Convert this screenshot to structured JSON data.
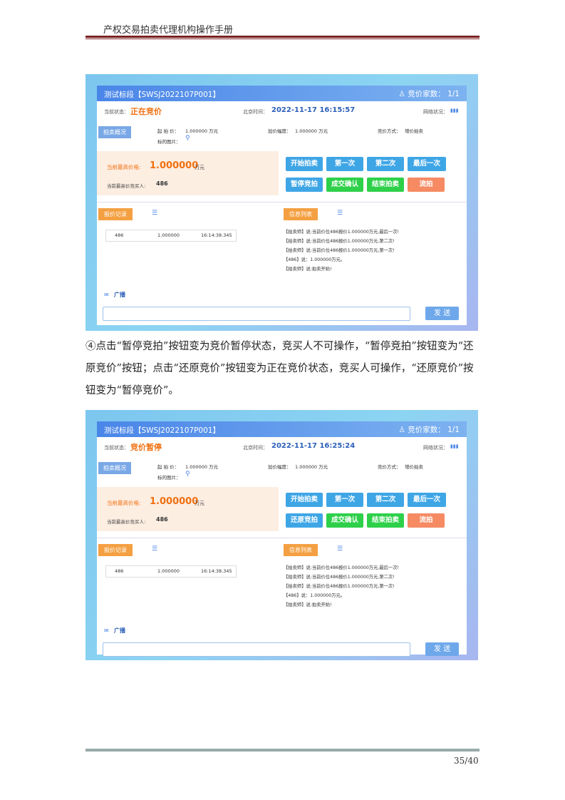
{
  "header": {
    "title": "产权交易拍卖代理机构操作手册"
  },
  "footer": {
    "page": "35/40"
  },
  "paragraph": [
    "④点击“暂停竞拍”按钮变为竞价暂停状态，竞买人不可操作，“暂停竞拍”按钮变为“还",
    "原竞价”按钮；点击“还原竞价”按钮变为正在竞价状态，竞买人可操作，“还原竞价”按",
    "钮变为“暂停竞价”。"
  ],
  "screens": [
    {
      "title": "测试标段【SWSJ2022107P001】",
      "bidder_count_label": "竞价家数：",
      "bidder_count": "1/1",
      "state_label": "当前状态：",
      "state": "正在竞价",
      "time_label": "北京时间：",
      "time": "2022-11-17 16:15:57",
      "network_label": "网络状况：",
      "overview_tag": "拍卖概况",
      "start_price_label": "起 拍 价：",
      "start_price": "1.000000 万元",
      "increment_label": "加价幅度：",
      "increment": "1.000000 万元",
      "method_label": "竞价方式：",
      "method": "增价拍卖",
      "image_label": "标的图片：",
      "high_label": "当前最高价格:",
      "high_value": "1.000000",
      "high_unit": "万元",
      "buyer_label": "当前最高价竞买人:",
      "buyer": "486",
      "buttons": [
        "开始拍卖",
        "第一次",
        "第二次",
        "最后一次",
        "暂停竞拍",
        "成交确认",
        "结束拍卖",
        "流拍"
      ],
      "record_tag": "报价记录",
      "info_tag": "信息列表",
      "record": {
        "bidder": "486",
        "price": "1.000000",
        "time": "16:14:38.345"
      },
      "messages": [
        "【拍卖师】说:当前价位486报价1.000000万元,最后一次!",
        "【拍卖师】说:当前价位486报价1.000000万元,第二次!",
        "【拍卖师】说:当前价位486报价1.000000万元,第一次!",
        "【486】说：1.000000万元。",
        "【拍卖师】说:拍卖开始!"
      ],
      "broadcast": "广播",
      "send": "发 送"
    },
    {
      "title": "测试标段【SWSJ2022107P001】",
      "bidder_count_label": "竞价家数：",
      "bidder_count": "1/1",
      "state_label": "当前状态：",
      "state": "竞价暂停",
      "time_label": "北京时间：",
      "time": "2022-11-17 16:25:24",
      "network_label": "网络状况：",
      "overview_tag": "拍卖概况",
      "start_price_label": "起 拍 价：",
      "start_price": "1.000000 万元",
      "increment_label": "加价幅度：",
      "increment": "1.000000 万元",
      "method_label": "竞价方式：",
      "method": "增价拍卖",
      "image_label": "标的图片：",
      "high_label": "当前最高价格:",
      "high_value": "1.000000",
      "high_unit": "万元",
      "buyer_label": "当前最高价竞买人:",
      "buyer": "486",
      "buttons": [
        "开始拍卖",
        "第一次",
        "第二次",
        "最后一次",
        "还原竞拍",
        "成交确认",
        "结束拍卖",
        "流拍"
      ],
      "record_tag": "报价记录",
      "info_tag": "信息列表",
      "record": {
        "bidder": "486",
        "price": "1.000000",
        "time": "16:14:38.345"
      },
      "messages": [
        "【拍卖师】说:当前价位486报价1.000000万元,最后一次!",
        "【拍卖师】说:当前价位486报价1.000000万元,第二次!",
        "【拍卖师】说:当前价位486报价1.000000万元,第一次!",
        "【486】说：1.000000万元。",
        "【拍卖师】说:拍卖开始!"
      ],
      "broadcast": "广播",
      "send": "发 送"
    }
  ]
}
